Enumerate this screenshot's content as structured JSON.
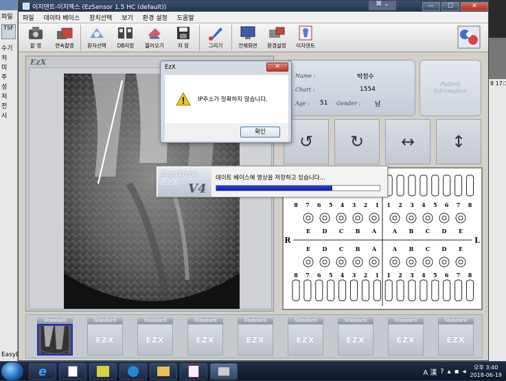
{
  "background_app": {
    "left_menu": "파일",
    "left_tab": "TSF",
    "left_lines": [
      "수기",
      "처",
      "미",
      "주",
      "성",
      "처",
      "전",
      "시"
    ],
    "left_status": "EasyD",
    "right_text": "8 17:3"
  },
  "window": {
    "title": "이지덴트-이지엑스 (EzSensor 1.5 HC (default))",
    "minimize": "—",
    "maximize": "☐",
    "close": "✕",
    "extra_controls": "⌘ ⌄"
  },
  "menu": [
    "파일",
    "데이타 베이스",
    "장치선택",
    "보기",
    "환경 설정",
    "도움말"
  ],
  "toolbar": [
    {
      "label": "촬 영",
      "icon": "camera-icon"
    },
    {
      "label": "연속촬영",
      "icon": "continuous-capture-icon"
    },
    {
      "label": "환자선택",
      "icon": "patient-select-icon"
    },
    {
      "label": "DB저장",
      "icon": "db-save-icon"
    },
    {
      "label": "불러오기",
      "icon": "load-icon"
    },
    {
      "label": "저 장",
      "icon": "save-icon"
    },
    {
      "label": "그리기",
      "icon": "draw-icon"
    },
    {
      "label": "전체화면",
      "icon": "fullscreen-icon"
    },
    {
      "label": "환경설정",
      "icon": "settings-icon"
    },
    {
      "label": "이지덴트",
      "icon": "ezdent-icon"
    }
  ],
  "viewer": {
    "logo": "EzX"
  },
  "patient": {
    "name_label": "Name :",
    "name": "박정수",
    "chart_label": "Chart :",
    "chart": "1554",
    "age_label": "Age :",
    "age": "51",
    "gender_label": "Gender :",
    "gender": "남",
    "info_button": "Patient\nInformation"
  },
  "tools": [
    {
      "name": "rotate-ccw",
      "icon": "rotate-left-icon",
      "glyph": "↺"
    },
    {
      "name": "rotate-cw",
      "icon": "rotate-right-icon",
      "glyph": "↻"
    },
    {
      "name": "flip-horizontal",
      "icon": "flip-horizontal-icon",
      "glyph": "↔"
    },
    {
      "name": "flip-vertical",
      "icon": "flip-vertical-icon",
      "glyph": "↕"
    }
  ],
  "dental_chart": {
    "upper_permanent": [
      "8",
      "7",
      "6",
      "5",
      "4",
      "3",
      "2",
      "1",
      "1",
      "2",
      "3",
      "4",
      "5",
      "6",
      "7",
      "8"
    ],
    "upper_primary": [
      "E",
      "D",
      "C",
      "B",
      "A",
      "A",
      "B",
      "C",
      "D",
      "E"
    ],
    "lower_primary": [
      "E",
      "D",
      "C",
      "B",
      "A",
      "A",
      "B",
      "C",
      "D",
      "E"
    ],
    "lower_permanent": [
      "8",
      "7",
      "6",
      "5",
      "4",
      "3",
      "2",
      "1",
      "1",
      "2",
      "3",
      "4",
      "5",
      "6",
      "7",
      "8"
    ],
    "right_label": "R",
    "left_label": "L"
  },
  "thumbnails": {
    "header": "Standard",
    "count": 9,
    "selected_index": 0,
    "placeholder_mark": "EZX"
  },
  "dialog": {
    "title": "EzX",
    "close": "✕",
    "message": "IP주소가 정확하지 않습니다.",
    "ok": "확인"
  },
  "progress": {
    "logo_top": "EasyDent",
    "logo_mid": "EzX",
    "logo_ver": "V4",
    "message": "데이트 베이스에 영상을 저장하고 있습니다...",
    "percent": 0.71
  },
  "taskbar": {
    "time": "오후 3:40",
    "date": "2018-06-19",
    "ime": "A 漢",
    "apps": [
      "ie-icon",
      "notepad-icon",
      "winamp-icon",
      "teamviewer-icon",
      "explorer-icon",
      "ezdent-task-icon",
      "ezx-task-icon"
    ]
  },
  "colors": {
    "progress_fill": "#0a1fa8",
    "selected_thumb_border": "#1d2bd0",
    "dialog_close": "#c03a28"
  }
}
